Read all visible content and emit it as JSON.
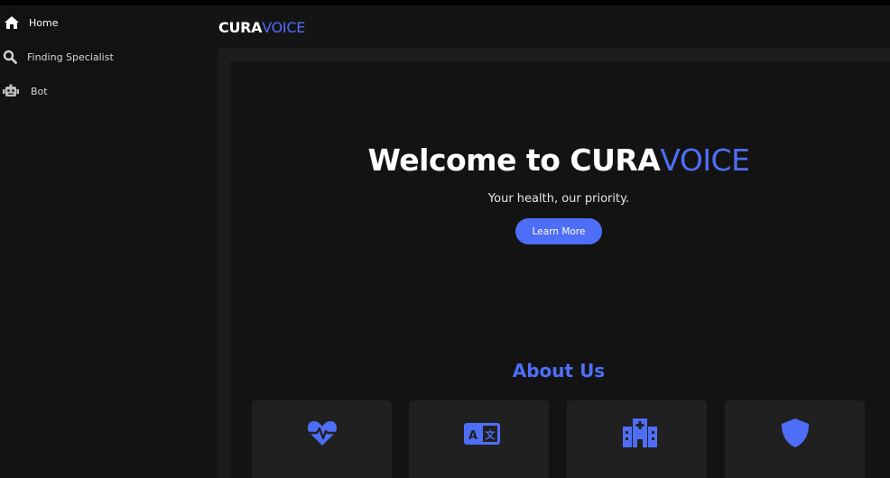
{
  "sidebar": {
    "items": [
      {
        "label": "Home",
        "icon": "home-icon"
      },
      {
        "label": "Finding Specialist",
        "icon": "search-icon"
      },
      {
        "label": "Bot",
        "icon": "robot-icon"
      }
    ]
  },
  "header": {
    "brand_part1": "CURA",
    "brand_part2": "VOICE"
  },
  "hero": {
    "title_part1": "Welcome to CURA",
    "title_part2": "VOICE",
    "subtitle": "Your health, our priority.",
    "button_label": "Learn More"
  },
  "about": {
    "title": "About Us",
    "cards": [
      {
        "icon": "heartbeat-icon"
      },
      {
        "icon": "language-icon"
      },
      {
        "icon": "hospital-icon"
      },
      {
        "icon": "shield-icon"
      }
    ]
  },
  "colors": {
    "accent": "#4f6ef7",
    "background": "#141414",
    "sidebar": "#121212",
    "card": "#202020"
  }
}
